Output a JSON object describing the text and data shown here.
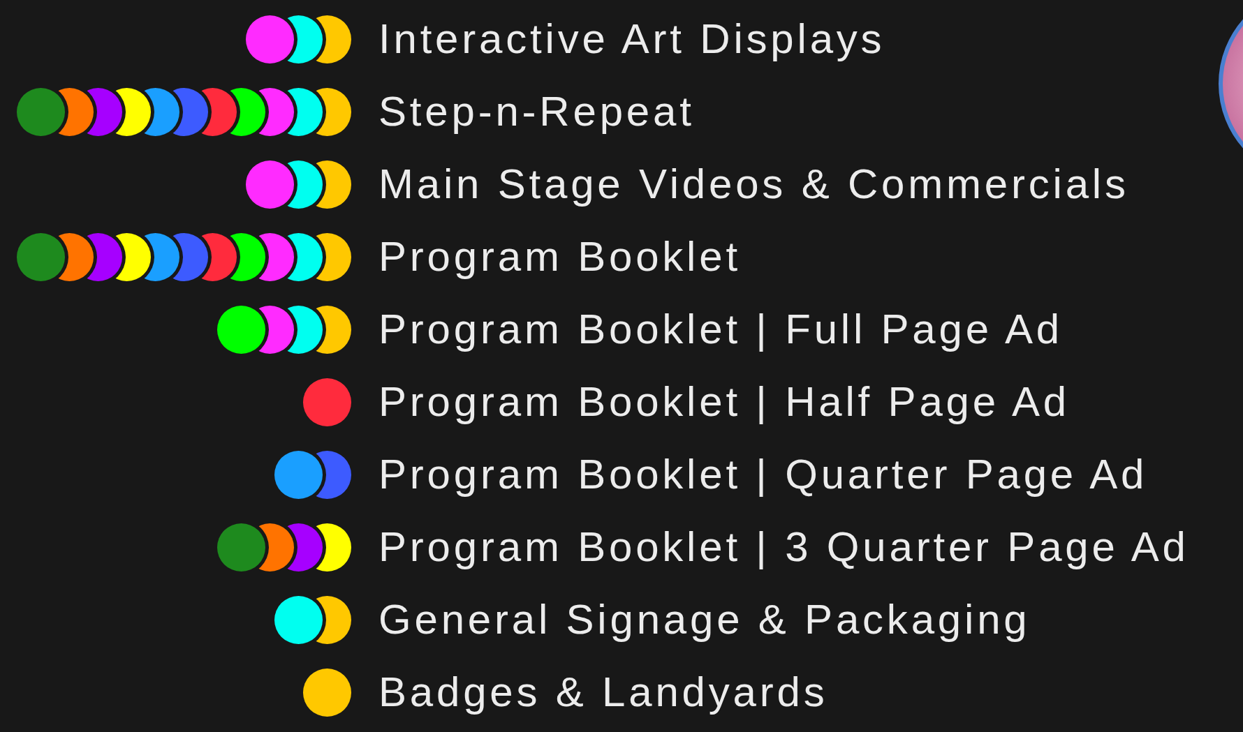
{
  "rows": [
    {
      "label": "Interactive Art Displays",
      "dots": [
        {
          "color": "#ff2bff"
        },
        {
          "color": "#00fff0"
        },
        {
          "color": "#ffc800"
        }
      ]
    },
    {
      "label": "Step-n-Repeat",
      "dots": [
        {
          "color": "#1e8a1e"
        },
        {
          "color": "#ff7300"
        },
        {
          "color": "#a600ff"
        },
        {
          "color": "#ffff00"
        },
        {
          "color": "#1a9fff"
        },
        {
          "color": "#3d5bff"
        },
        {
          "color": "#ff2b3d"
        },
        {
          "color": "#00ff00"
        },
        {
          "color": "#ff2bff"
        },
        {
          "color": "#00fff0"
        },
        {
          "color": "#ffc800"
        }
      ]
    },
    {
      "label": "Main Stage Videos & Commercials",
      "dots": [
        {
          "color": "#ff2bff"
        },
        {
          "color": "#00fff0"
        },
        {
          "color": "#ffc800"
        }
      ]
    },
    {
      "label": "Program Booklet",
      "dots": [
        {
          "color": "#1e8a1e"
        },
        {
          "color": "#ff7300"
        },
        {
          "color": "#a600ff"
        },
        {
          "color": "#ffff00"
        },
        {
          "color": "#1a9fff"
        },
        {
          "color": "#3d5bff"
        },
        {
          "color": "#ff2b3d"
        },
        {
          "color": "#00ff00"
        },
        {
          "color": "#ff2bff"
        },
        {
          "color": "#00fff0"
        },
        {
          "color": "#ffc800"
        }
      ]
    },
    {
      "label": "Program Booklet | Full Page Ad",
      "dots": [
        {
          "color": "#00ff00"
        },
        {
          "color": "#ff2bff"
        },
        {
          "color": "#00fff0"
        },
        {
          "color": "#ffc800"
        }
      ]
    },
    {
      "label": "Program Booklet | Half Page Ad",
      "dots": [
        {
          "color": "#ff2b3d"
        }
      ]
    },
    {
      "label": "Program Booklet | Quarter Page Ad",
      "dots": [
        {
          "color": "#1a9fff"
        },
        {
          "color": "#3d5bff"
        }
      ]
    },
    {
      "label": "Program Booklet | 3 Quarter Page Ad",
      "dots": [
        {
          "color": "#1e8a1e"
        },
        {
          "color": "#ff7300"
        },
        {
          "color": "#a600ff"
        },
        {
          "color": "#ffff00"
        }
      ]
    },
    {
      "label": "General Signage & Packaging",
      "dots": [
        {
          "color": "#00fff0"
        },
        {
          "color": "#ffc800"
        }
      ]
    },
    {
      "label": "Badges & Landyards",
      "dots": [
        {
          "color": "#ffc800"
        }
      ]
    }
  ]
}
